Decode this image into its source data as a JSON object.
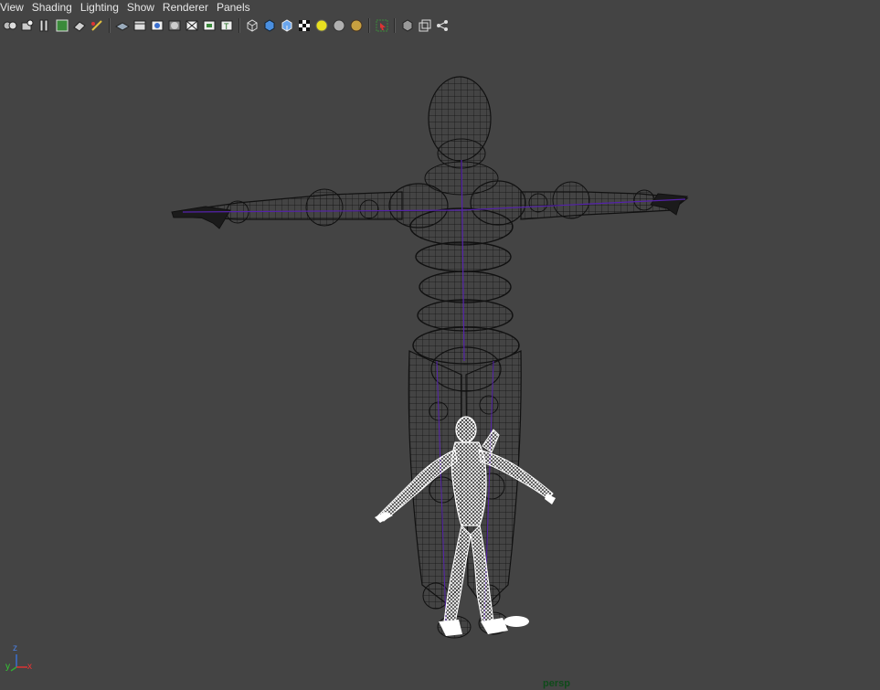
{
  "menu": {
    "items": [
      {
        "label": "View"
      },
      {
        "label": "Shading"
      },
      {
        "label": "Lighting"
      },
      {
        "label": "Show"
      },
      {
        "label": "Renderer"
      },
      {
        "label": "Panels"
      }
    ]
  },
  "toolbar": {
    "icons": [
      "select-camera-icon",
      "camera-attributes-icon",
      "bookmarks-icon",
      "image-plane-icon",
      "two-d-pan-zoom-icon",
      "grease-pencil-icon",
      "grid-icon",
      "film-gate-icon",
      "resolution-gate-icon",
      "gate-mask-icon",
      "field-chart-icon",
      "safe-action-icon",
      "safe-title-icon",
      "wireframe-icon",
      "smooth-shade-icon",
      "wireframe-on-shaded-icon",
      "textured-icon",
      "use-all-lights-icon",
      "shadows-icon",
      "screen-space-ao-icon",
      "isolate-select-icon",
      "xray-icon",
      "xray-active-components-icon",
      "xray-joints-icon"
    ]
  },
  "viewport": {
    "camera_label": "persp",
    "axis": {
      "z": "z",
      "y": "y",
      "x": "x"
    },
    "colors": {
      "background": "#444444",
      "wire": "#111111",
      "selected": "#ffffff",
      "joints": "#5522aa"
    }
  }
}
